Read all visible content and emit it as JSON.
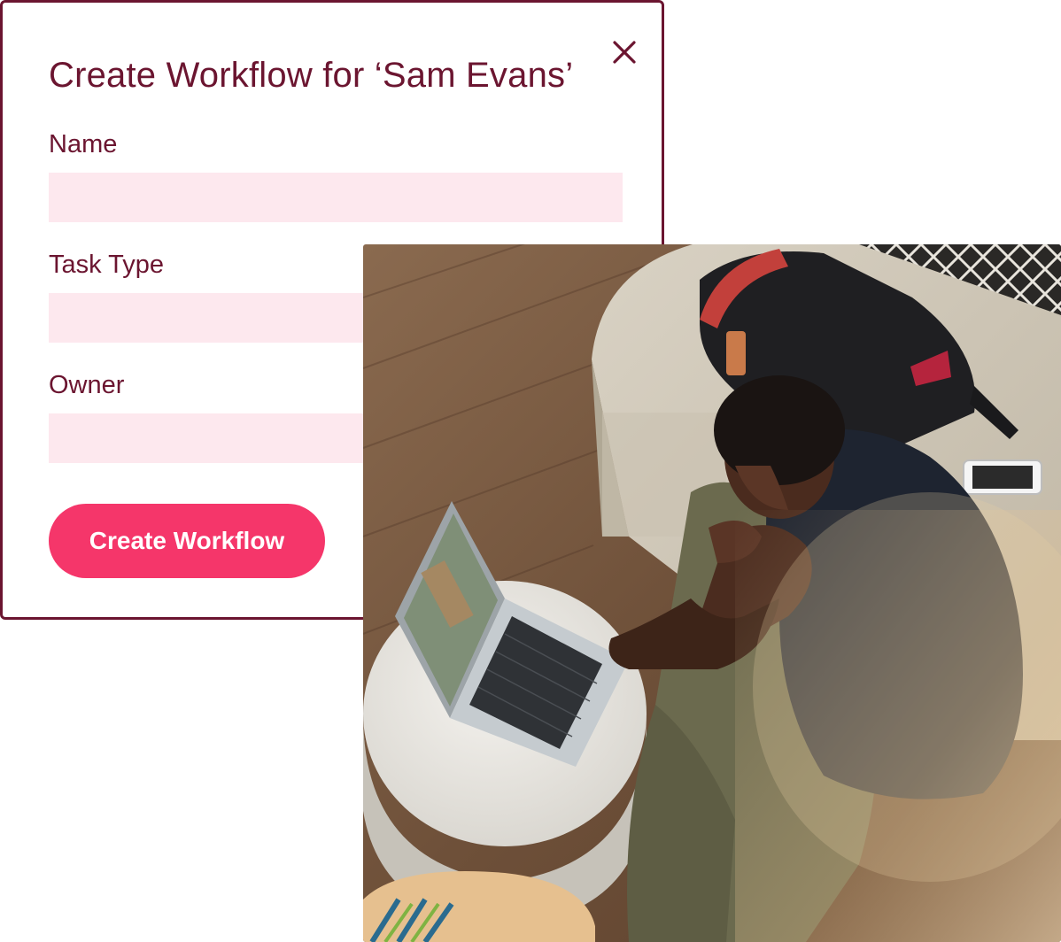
{
  "dialog": {
    "title": "Create Workflow for ‘Sam Evans’",
    "close_icon": "close-icon",
    "fields": [
      {
        "label": "Name",
        "value": "",
        "placeholder": ""
      },
      {
        "label": "Task Type",
        "value": "",
        "placeholder": ""
      },
      {
        "label": "Owner",
        "value": "",
        "placeholder": ""
      }
    ],
    "submit_label": "Create Workflow"
  },
  "colors": {
    "accent": "#6b1530",
    "button": "#f5366a",
    "input_bg": "#fde8ee"
  }
}
